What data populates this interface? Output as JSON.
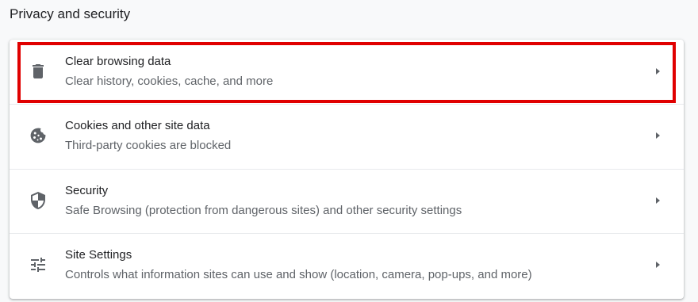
{
  "section": {
    "title": "Privacy and security"
  },
  "rows": [
    {
      "label": "Clear browsing data",
      "sublabel": "Clear history, cookies, cache, and more",
      "icon": "trash-icon"
    },
    {
      "label": "Cookies and other site data",
      "sublabel": "Third-party cookies are blocked",
      "icon": "cookie-icon"
    },
    {
      "label": "Security",
      "sublabel": "Safe Browsing (protection from dangerous sites) and other security settings",
      "icon": "shield-icon"
    },
    {
      "label": "Site Settings",
      "sublabel": "Controls what information sites can use and show (location, camera, pop-ups, and more)",
      "icon": "tune-icon"
    }
  ],
  "colors": {
    "highlight": "#e00000",
    "icon": "#5f6368",
    "text": "#202124",
    "secondary_text": "#5f6368"
  }
}
